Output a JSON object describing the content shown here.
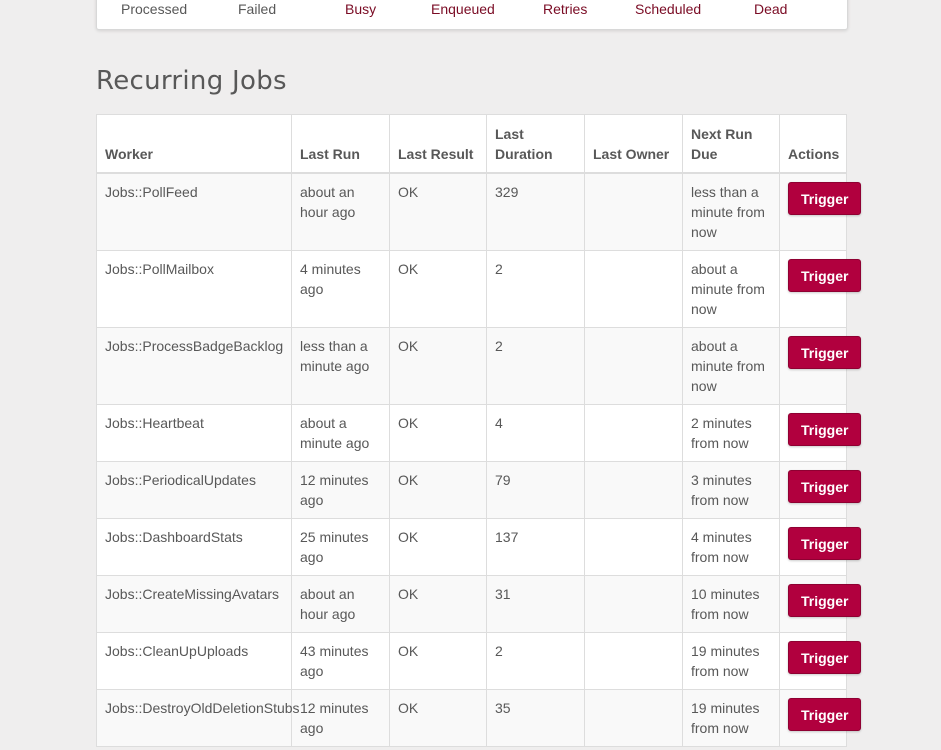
{
  "stats": {
    "processed": "Processed",
    "failed": "Failed",
    "busy": "Busy",
    "enqueued": "Enqueued",
    "retries": "Retries",
    "scheduled": "Scheduled",
    "dead": "Dead"
  },
  "page_title": "Recurring Jobs",
  "table": {
    "headers": {
      "worker": "Worker",
      "last_run": "Last Run",
      "last_result": "Last Result",
      "last_duration": "Last Duration",
      "last_owner": "Last Owner",
      "next_run_due": "Next Run Due",
      "actions": "Actions"
    },
    "rows": [
      {
        "worker": "Jobs::PollFeed",
        "last_run": "about an hour ago",
        "last_result": "OK",
        "last_duration": "329",
        "last_owner": "",
        "next_run_due": "less than a minute from now",
        "action": "Trigger"
      },
      {
        "worker": "Jobs::PollMailbox",
        "last_run": "4 minutes ago",
        "last_result": "OK",
        "last_duration": "2",
        "last_owner": "",
        "next_run_due": "about a minute from now",
        "action": "Trigger"
      },
      {
        "worker": "Jobs::ProcessBadgeBacklog",
        "last_run": "less than a minute ago",
        "last_result": "OK",
        "last_duration": "2",
        "last_owner": "",
        "next_run_due": "about a minute from now",
        "action": "Trigger"
      },
      {
        "worker": "Jobs::Heartbeat",
        "last_run": "about a minute ago",
        "last_result": "OK",
        "last_duration": "4",
        "last_owner": "",
        "next_run_due": "2 minutes from now",
        "action": "Trigger"
      },
      {
        "worker": "Jobs::PeriodicalUpdates",
        "last_run": "12 minutes ago",
        "last_result": "OK",
        "last_duration": "79",
        "last_owner": "",
        "next_run_due": "3 minutes from now",
        "action": "Trigger"
      },
      {
        "worker": "Jobs::DashboardStats",
        "last_run": "25 minutes ago",
        "last_result": "OK",
        "last_duration": "137",
        "last_owner": "",
        "next_run_due": "4 minutes from now",
        "action": "Trigger"
      },
      {
        "worker": "Jobs::CreateMissingAvatars",
        "last_run": "about an hour ago",
        "last_result": "OK",
        "last_duration": "31",
        "last_owner": "",
        "next_run_due": "10 minutes from now",
        "action": "Trigger"
      },
      {
        "worker": "Jobs::CleanUpUploads",
        "last_run": "43 minutes ago",
        "last_result": "OK",
        "last_duration": "2",
        "last_owner": "",
        "next_run_due": "19 minutes from now",
        "action": "Trigger"
      },
      {
        "worker": "Jobs::DestroyOldDeletionStubs",
        "last_run": "12 minutes ago",
        "last_result": "OK",
        "last_duration": "35",
        "last_owner": "",
        "next_run_due": "19 minutes from now",
        "action": "Trigger"
      }
    ]
  },
  "colors": {
    "accent": "#b1003e",
    "link": "#7a0b24",
    "text": "#585858",
    "background": "#efeeee"
  }
}
